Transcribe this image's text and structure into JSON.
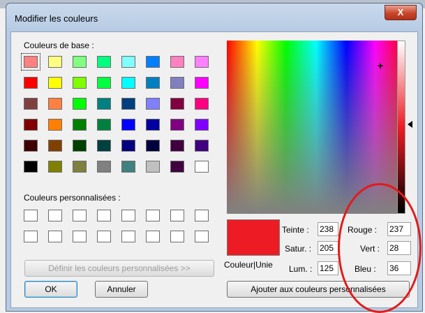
{
  "window": {
    "title": "Modifier les couleurs",
    "close_glyph": "X"
  },
  "basic": {
    "label": "Couleurs de base :",
    "rows": [
      [
        "#ff8080",
        "#ffff80",
        "#80ff80",
        "#00ff80",
        "#80ffff",
        "#0080ff",
        "#ff80c0",
        "#ff80ff"
      ],
      [
        "#ff0000",
        "#ffff00",
        "#80ff00",
        "#00ff40",
        "#00ffff",
        "#0080c0",
        "#8080c0",
        "#ff00ff"
      ],
      [
        "#804040",
        "#ff8040",
        "#00ff00",
        "#008080",
        "#004080",
        "#8080ff",
        "#800040",
        "#ff0080"
      ],
      [
        "#800000",
        "#ff8000",
        "#008000",
        "#008040",
        "#0000ff",
        "#0000a0",
        "#800080",
        "#8000ff"
      ],
      [
        "#400000",
        "#804000",
        "#004000",
        "#004040",
        "#000080",
        "#000040",
        "#400040",
        "#400080"
      ],
      [
        "#000000",
        "#808000",
        "#808040",
        "#808080",
        "#408080",
        "#c0c0c0",
        "#400040",
        "#ffffff"
      ]
    ]
  },
  "custom": {
    "label": "Couleurs personnalisées :",
    "define_button": "Définir les couleurs personnalisées >>"
  },
  "buttons": {
    "ok": "OK",
    "cancel": "Annuler",
    "add": "Ajouter aux couleurs personnalisées"
  },
  "preview": {
    "label": "Couleur|Unie",
    "color": "#ed1c24"
  },
  "hsl": {
    "hue_label": "Teinte :",
    "hue": "238",
    "sat_label": "Satur. :",
    "sat": "205",
    "lum_label": "Lum. :",
    "lum": "125"
  },
  "rgb": {
    "red_label": "Rouge :",
    "red": "237",
    "green_label": "Vert :",
    "green": "28",
    "blue_label": "Bleu :",
    "blue": "36"
  },
  "annotation": {
    "color": "#e11b1b"
  }
}
